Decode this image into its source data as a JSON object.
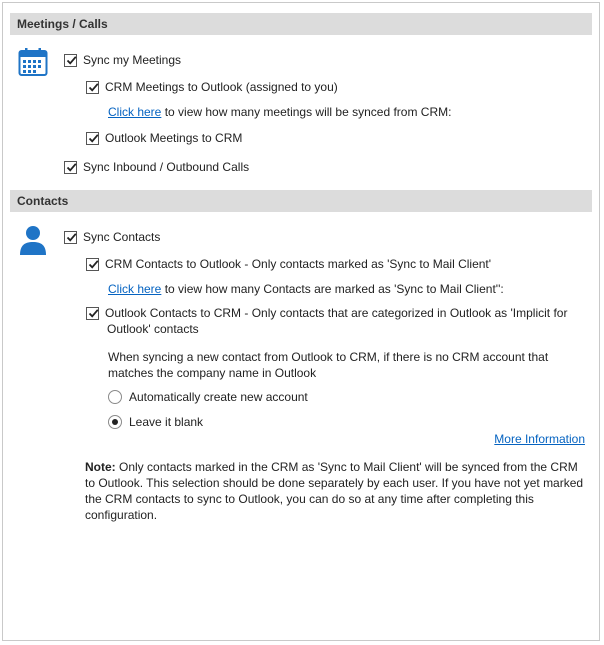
{
  "meetings": {
    "header": "Meetings / Calls",
    "sync_meetings": "Sync my Meetings",
    "crm_to_outlook": "CRM Meetings to Outlook (assigned to you)",
    "click_here": "Click here",
    "click_here_suffix": " to view how many meetings will be synced from CRM:",
    "outlook_to_crm": "Outlook Meetings to CRM",
    "sync_calls": "Sync Inbound / Outbound Calls"
  },
  "contacts": {
    "header": "Contacts",
    "sync_contacts": "Sync Contacts",
    "crm_to_outlook": "CRM Contacts to Outlook - Only contacts marked as 'Sync to Mail Client'",
    "click_here": "Click here",
    "click_here_suffix": " to view how many Contacts are marked as 'Sync to Mail Client'':",
    "outlook_to_crm_line1": "Outlook Contacts to CRM - Only contacts that are categorized in Outlook as 'Implicit for",
    "outlook_to_crm_line2": "Outlook' contacts",
    "new_contact_line1": "When syncing a new contact from Outlook to CRM, if there is no CRM account that",
    "new_contact_line2": "matches the company name in Outlook",
    "radio_create": "Automatically create new account",
    "radio_blank": "Leave it blank",
    "more_info": "More Information",
    "note_label": "Note:",
    "note_line1": " Only contacts marked in the CRM as 'Sync to Mail Client' will be synced from the CRM",
    "note_line2": "to Outlook. This selection should be done separately by each user. If you have not yet marked",
    "note_line3": "the CRM contacts to sync to Outlook, you can do so at any time after completing this",
    "note_line4": "configuration."
  },
  "colors": {
    "accent": "#1f74c6",
    "header_bg": "#dcdcdc",
    "link": "#0563c1"
  },
  "icons": {
    "meetings": "calendar-icon",
    "contacts": "person-icon",
    "check": "checkmark-icon"
  }
}
